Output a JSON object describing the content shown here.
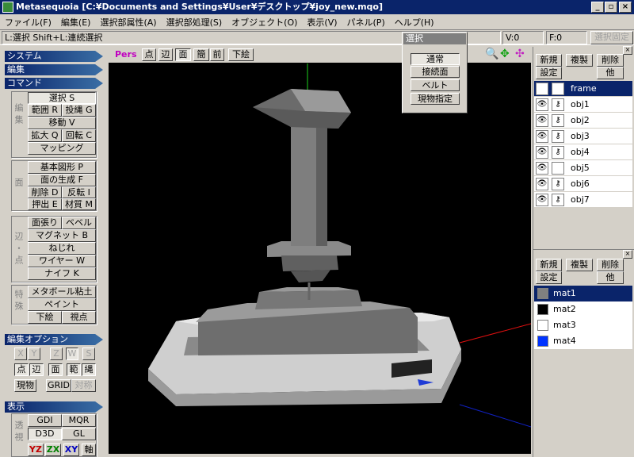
{
  "titlebar": {
    "title": "Metasequoia [C:¥Documents and Settings¥User¥デスクトップ¥joy_new.mqo]",
    "min": "_",
    "max": "▫",
    "close": "×"
  },
  "menu": [
    "ファイル(F)",
    "編集(E)",
    "選択部属性(A)",
    "選択部処理(S)",
    "オブジェクト(O)",
    "表示(V)",
    "パネル(P)",
    "ヘルプ(H)"
  ],
  "status": {
    "hint": "L:選択  Shift+L:連続選択",
    "v": "V:0",
    "f": "F:0",
    "fixed": "選択固定"
  },
  "left": {
    "system": "システム",
    "edit": "編集",
    "command": "コマンド",
    "edit_group_label": "編集",
    "select": "選択 S",
    "range": "範囲 R",
    "lasso": "投縄 G",
    "move": "移動 V",
    "scale": "拡大 Q",
    "rotate": "回転 C",
    "mapping": "マッピング",
    "face_group_label": "面",
    "basic_shape": "基本図形 P",
    "face_gen": "面の生成 F",
    "delete": "削除 D",
    "invert": "反転 I",
    "extrude": "押出 E",
    "material": "材質 M",
    "edge_group_label": "辺・点",
    "face_tension": "面張り",
    "bevel": "ベベル",
    "magnet": "マグネット B",
    "twist": "ねじれ",
    "wire": "ワイヤー W",
    "knife": "ナイフ K",
    "special_group_label": "特殊",
    "metaball": "メタボール粘土",
    "paint": "ペイント",
    "underlay": "下絵",
    "viewpoint": "視点",
    "edit_option": "編集オプション",
    "x": "X",
    "y": "Y",
    "z": "Z",
    "w": "W",
    "s": "S",
    "pt": "点",
    "ed": "辺",
    "fc": "面",
    "rng": "範",
    "lso": "縄",
    "real": "現物",
    "grid": "GRID",
    "sym": "対称",
    "display": "表示",
    "display_group_label": "透視",
    "gdi": "GDI",
    "mqr": "MQR",
    "d3d": "D3D",
    "gl": "GL",
    "yz": "YZ",
    "zx": "ZX",
    "xy": "XY",
    "axis": "軸"
  },
  "viewport": {
    "pers": "Pers",
    "pt": "点",
    "ed": "辺",
    "fc": "面",
    "simple": "簡",
    "front": "前",
    "underlay": "下絵"
  },
  "popup": {
    "title": "選択",
    "normal": "通常",
    "connected": "接続面",
    "belt": "ベルト",
    "real": "現物指定"
  },
  "objpanel": {
    "new": "新規",
    "dup": "複製",
    "del": "削除",
    "settings": "設定",
    "other": "他",
    "layers": [
      "frame",
      "obj1",
      "obj2",
      "obj3",
      "obj4",
      "obj5",
      "obj6",
      "obj7"
    ],
    "selected": 0
  },
  "matpanel": {
    "new": "新規",
    "dup": "複製",
    "del": "削除",
    "settings": "設定",
    "other": "他",
    "materials": [
      {
        "name": "mat1",
        "color": "#808080"
      },
      {
        "name": "mat2",
        "color": "#000000"
      },
      {
        "name": "mat3",
        "color": "#ffffff"
      },
      {
        "name": "mat4",
        "color": "#0033ff"
      }
    ],
    "selected": 0
  },
  "colors": {
    "accent": "#0a246a",
    "viewport_bg": "#000000"
  }
}
